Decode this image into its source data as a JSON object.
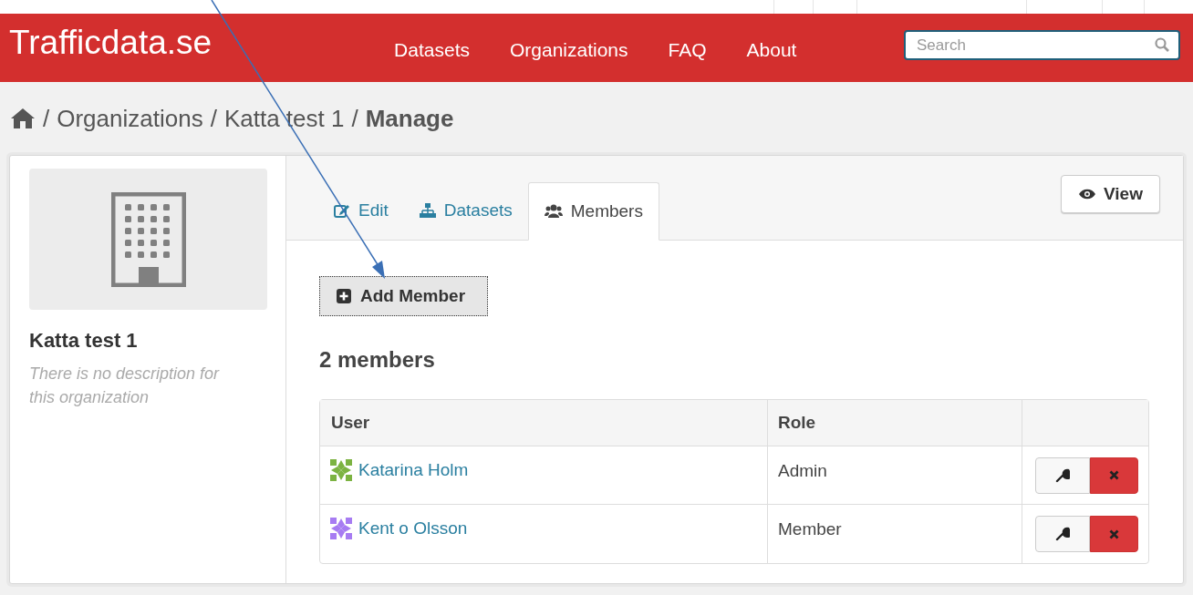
{
  "header": {
    "logo": "Trafficdata.se",
    "nav": [
      "Datasets",
      "Organizations",
      "FAQ",
      "About"
    ],
    "search": {
      "placeholder": "Search"
    }
  },
  "breadcrumb": {
    "separator": "/",
    "items": [
      "Organizations",
      "Katta test 1"
    ],
    "current": "Manage"
  },
  "organization": {
    "name": "Katta test 1",
    "description": "There is no description for this organization"
  },
  "tabs": [
    {
      "label": "Edit",
      "kind": "edit",
      "selected": false
    },
    {
      "label": "Datasets",
      "kind": "datasets",
      "selected": false
    },
    {
      "label": "Members",
      "kind": "members",
      "selected": true
    }
  ],
  "view_button": "View",
  "add_button": "Add Member",
  "members_count": "2 members",
  "table": {
    "columns": [
      "User",
      "Role"
    ],
    "rows": [
      {
        "user": "Katarina Holm",
        "role": "Admin",
        "color": "#7cb342"
      },
      {
        "user": "Kent o Olsson",
        "role": "Member",
        "color": "#a77cf2"
      }
    ]
  }
}
